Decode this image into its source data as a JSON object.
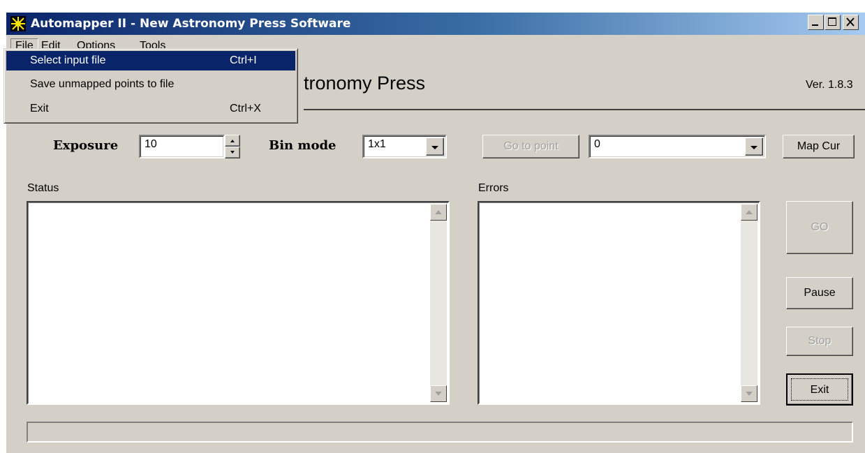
{
  "window": {
    "title": "Automapper II - New Astronomy Press Software"
  },
  "menubar": {
    "items": [
      "File",
      "Edit",
      "Options",
      "Tools"
    ]
  },
  "file_menu": {
    "items": [
      {
        "label": "Select input file",
        "accelerator": "Ctrl+I",
        "selected": true
      },
      {
        "label": "Save unmapped points to file",
        "accelerator": ""
      },
      {
        "label": "Exit",
        "accelerator": "Ctrl+X"
      }
    ]
  },
  "header": {
    "title_visible": "tronomy Press",
    "version": "Ver. 1.8.3"
  },
  "controls": {
    "exposure_label": "Exposure",
    "exposure_value": "10",
    "bin_mode_label": "Bin mode",
    "bin_mode_value": "1x1",
    "go_to_point_label": "Go to point",
    "point_value": "0",
    "map_cur_label": "Map Cur"
  },
  "panels": {
    "status_label": "Status",
    "errors_label": "Errors"
  },
  "buttons": {
    "go": "GO",
    "pause": "Pause",
    "stop": "Stop",
    "exit": "Exit"
  },
  "colors": {
    "title_gradient_start": "#0a246a",
    "title_gradient_end": "#a6caf0",
    "face": "#d4d0c8",
    "menu_highlight": "#0a246a"
  }
}
